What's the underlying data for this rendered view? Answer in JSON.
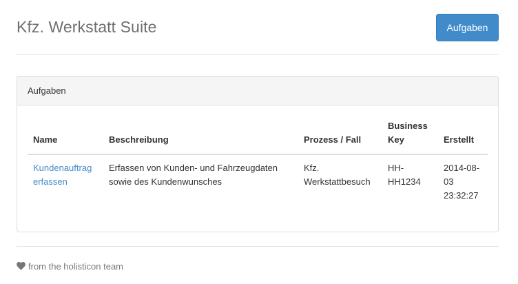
{
  "header": {
    "title": "Kfz. Werkstatt Suite",
    "button_label": "Aufgaben"
  },
  "panel": {
    "heading": "Aufgaben",
    "columns": {
      "name": "Name",
      "description": "Beschreibung",
      "process": "Prozess / Fall",
      "business_key": "Business Key",
      "created": "Erstellt"
    },
    "rows": [
      {
        "name": "Kundenauftrag erfassen",
        "description": "Erfassen von Kunden- und Fahrzeugdaten sowie des Kundenwunsches",
        "process": "Kfz. Werkstattbesuch",
        "business_key": "HH-HH1234",
        "created": "2014-08-03 23:32:27"
      }
    ]
  },
  "footer": {
    "icon": "heart-icon",
    "text": "from the holisticon team"
  },
  "colors": {
    "primary": "#428bca",
    "link": "#428bca",
    "muted": "#777777"
  }
}
